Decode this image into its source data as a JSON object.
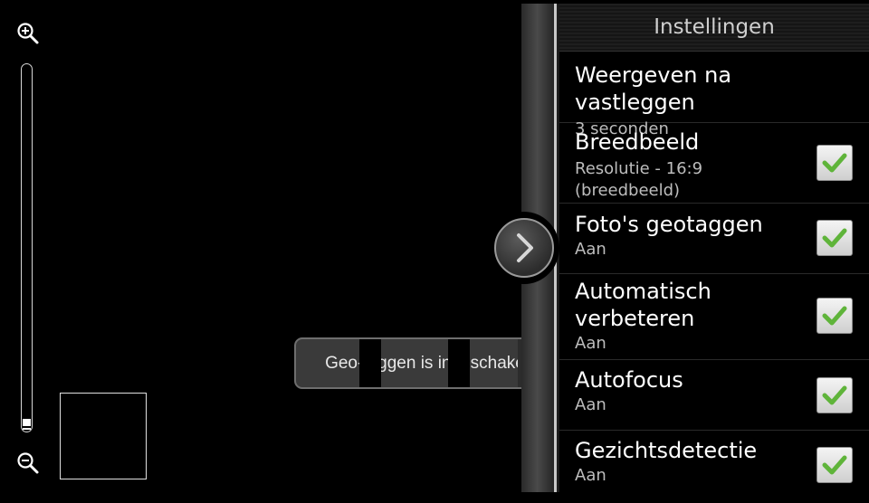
{
  "panel": {
    "title": "Instellingen",
    "items": [
      {
        "title": "Weergeven na vastleggen",
        "subtitle": "3 seconden",
        "checked": null
      },
      {
        "title": "Breedbeeld",
        "subtitle": "Resolutie - 16:9 (breedbeeld)",
        "checked": true
      },
      {
        "title": "Foto's geotaggen",
        "subtitle": "Aan",
        "checked": true
      },
      {
        "title": "Automatisch verbeteren",
        "subtitle": "Aan",
        "checked": true
      },
      {
        "title": "Autofocus",
        "subtitle": "Aan",
        "checked": true
      },
      {
        "title": "Gezichtsdetectie",
        "subtitle": "Aan",
        "checked": true
      }
    ]
  },
  "toast": {
    "text": "Geo-taggen is ingeschakeld."
  },
  "icons": {
    "zoom_in": "zoom-in-icon",
    "zoom_out": "zoom-out-icon",
    "collapse": "chevron-right-icon",
    "check": "checkmark-icon"
  },
  "colors": {
    "check_green": "#5fb43a",
    "background": "#000000"
  }
}
